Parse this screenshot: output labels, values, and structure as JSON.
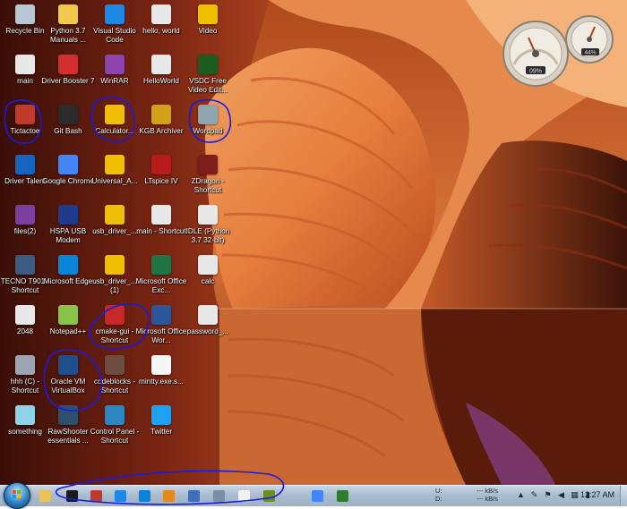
{
  "desktop": {
    "icons": [
      {
        "label": "Recycle Bin",
        "icon": "recycle-bin-icon",
        "color": "#b8c6d4"
      },
      {
        "label": "main",
        "icon": "python-file-icon",
        "color": "#e8e8e8"
      },
      {
        "label": "Tictactoe",
        "icon": "tictactoe-app-icon",
        "color": "#c0392b"
      },
      {
        "label": "Driver Talent",
        "icon": "driver-talent-icon",
        "color": "#1565c0"
      },
      {
        "label": "files(2)",
        "icon": "winrar-archive-icon",
        "color": "#7b3f9e"
      },
      {
        "label": "TECNO T901 - Shortcut",
        "icon": "phone-shortcut-icon",
        "color": "#3d5a80"
      },
      {
        "label": "2048",
        "icon": "python-file-icon",
        "color": "#e8e8e8"
      },
      {
        "label": "hhh (C) - Shortcut",
        "icon": "drive-shortcut-icon",
        "color": "#9aa5b1"
      },
      {
        "label": "something",
        "icon": "image-file-icon",
        "color": "#8fd3e8"
      },
      {
        "label": "Python 3.7 Manuals ...",
        "icon": "python-help-icon",
        "color": "#f2c94c"
      },
      {
        "label": "Driver Booster 7",
        "icon": "driver-booster-icon",
        "color": "#d32f2f"
      },
      {
        "label": "Git Bash",
        "icon": "git-bash-icon",
        "color": "#2b2b2b"
      },
      {
        "label": "Google Chrome",
        "icon": "chrome-icon",
        "color": "#4285f4"
      },
      {
        "label": "HSPA USB Modem",
        "icon": "modem-icon",
        "color": "#1e3a8a"
      },
      {
        "label": "Microsoft Edge",
        "icon": "edge-icon",
        "color": "#0a84d8"
      },
      {
        "label": "Notepad++",
        "icon": "notepad-plus-icon",
        "color": "#8bc34a"
      },
      {
        "label": "Oracle VM VirtualBox",
        "icon": "virtualbox-icon",
        "color": "#1f4e8c"
      },
      {
        "label": "RawShooter essentials ...",
        "icon": "camera-app-icon",
        "color": "#2f4f6f"
      },
      {
        "label": "Visual Studio Code",
        "icon": "vscode-icon",
        "color": "#1e88e5"
      },
      {
        "label": "WinRAR",
        "icon": "winrar-icon",
        "color": "#8e44ad"
      },
      {
        "label": "Calculator...",
        "icon": "folder-icon",
        "color": "#f0c000"
      },
      {
        "label": "Universal_A...",
        "icon": "folder-icon",
        "color": "#f0c000"
      },
      {
        "label": "usb_driver_...",
        "icon": "folder-icon",
        "color": "#f0c000"
      },
      {
        "label": "usb_driver_... (1)",
        "icon": "folder-icon",
        "color": "#f0c000"
      },
      {
        "label": "cmake-gui - Shortcut",
        "icon": "cmake-icon",
        "color": "#c62828"
      },
      {
        "label": "codeblocks - Shortcut",
        "icon": "codeblocks-icon",
        "color": "#6d4c41"
      },
      {
        "label": "Control Panel - Shortcut",
        "icon": "control-panel-icon",
        "color": "#2e86c1"
      },
      {
        "label": "hello, world",
        "icon": "python-file-icon",
        "color": "#e8e8e8"
      },
      {
        "label": "HelloWorld",
        "icon": "python-file-icon",
        "color": "#e8e8e8"
      },
      {
        "label": "KGB Archiver",
        "icon": "kgb-archiver-icon",
        "color": "#d4a017"
      },
      {
        "label": "LTspice IV",
        "icon": "ltspice-icon",
        "color": "#b71c1c"
      },
      {
        "label": "main - Shortcut",
        "icon": "python-file-icon",
        "color": "#e8e8e8"
      },
      {
        "label": "Microsoft Office Exc...",
        "icon": "excel-icon",
        "color": "#217346"
      },
      {
        "label": "Microsoft Office Wor...",
        "icon": "word-icon",
        "color": "#2b579a"
      },
      {
        "label": "mintty.exe.s...",
        "icon": "text-file-icon",
        "color": "#f5f5f5"
      },
      {
        "label": "Twitter",
        "icon": "twitter-icon",
        "color": "#1da1f2"
      },
      {
        "label": "Video",
        "icon": "folder-icon",
        "color": "#f0c000"
      },
      {
        "label": "VSDC Free Video Edit...",
        "icon": "vsdc-icon",
        "color": "#1b5e20"
      },
      {
        "label": "Wordpad",
        "icon": "wordpad-icon",
        "color": "#90a4ae"
      },
      {
        "label": "ZDragon - Shortcut",
        "icon": "zdragon-icon",
        "color": "#7f1d1d"
      },
      {
        "label": "IDLE (Python 3.7 32-bit)",
        "icon": "python-idle-icon",
        "color": "#e8e8e8"
      },
      {
        "label": "calc",
        "icon": "python-file-icon",
        "color": "#e8e8e8"
      },
      {
        "label": "password_...",
        "icon": "python-file-icon",
        "color": "#e8e8e8"
      }
    ]
  },
  "gadgets": {
    "cpu_percent": "09%",
    "memory_percent": "44%"
  },
  "taskbar": {
    "items": [
      {
        "icon": "file-explorer-icon",
        "color": "#e8c15a"
      },
      {
        "icon": "command-prompt-icon",
        "color": "#1a1a1a"
      },
      {
        "icon": "tictactoe-app-icon",
        "color": "#c0392b"
      },
      {
        "icon": "vscode-icon",
        "color": "#1e88e5"
      },
      {
        "icon": "edge-icon",
        "color": "#0a84d8"
      },
      {
        "icon": "sublime-text-icon",
        "color": "#e08a1e"
      },
      {
        "icon": "wordpad-icon",
        "color": "#3f6fb5"
      },
      {
        "icon": "paint-icon",
        "color": "#7a8fa6"
      },
      {
        "icon": "python-file-icon",
        "color": "#f2f2f2"
      },
      {
        "icon": "gimp-icon",
        "color": "#6b8e23"
      },
      {
        "icon": "chrome-icon",
        "color": "#4285f4"
      },
      {
        "icon": "network-app-icon",
        "color": "#2e7d32"
      }
    ],
    "network": {
      "upload_label": "U:",
      "download_label": "D:",
      "upload_value": "--- kB/s",
      "download_value": "--- kB/s"
    },
    "clock": "12:27 AM"
  },
  "colors": {
    "annotation": "#1a1ae6",
    "taskbar": "#a9bccf"
  }
}
